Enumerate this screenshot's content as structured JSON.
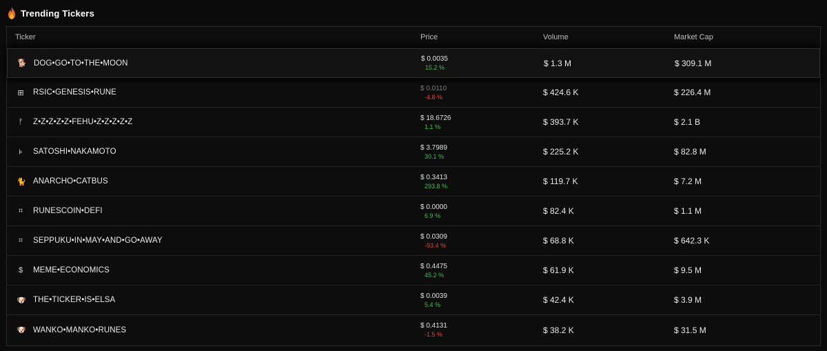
{
  "header": {
    "title": "Trending Tickers",
    "icon": "flame-icon"
  },
  "table": {
    "columns": [
      "Ticker",
      "Price",
      "Volume",
      "Market Cap"
    ],
    "rows": [
      {
        "icon": "🐕",
        "icon_name": "dog-icon",
        "ticker": "DOG•GO•TO•THE•MOON",
        "price": "$ 0.0035",
        "change": "15.2 %",
        "direction": "up",
        "volume": "$ 1.3 M",
        "market_cap": "$ 309.1 M"
      },
      {
        "icon": "⊞",
        "icon_name": "grid-icon",
        "ticker": "RSIC•GENESIS•RUNE",
        "price": "$ 0.0110",
        "change": "-4.8 %",
        "direction": "down",
        "volume": "$ 424.6 K",
        "market_cap": "$ 226.4 M"
      },
      {
        "icon": "ᚠ",
        "icon_name": "fehu-rune-icon",
        "ticker": "Z•Z•Z•Z•Z•FEHU•Z•Z•Z•Z•Z",
        "price": "$ 18.6726",
        "change": "1.1 %",
        "direction": "up",
        "volume": "$ 393.7 K",
        "market_cap": "$ 2.1 B"
      },
      {
        "icon": "⊧",
        "icon_name": "satoshi-icon",
        "ticker": "SATOSHI•NAKAMOTO",
        "price": "$ 3.7989",
        "change": "30.1 %",
        "direction": "up",
        "volume": "$ 225.2 K",
        "market_cap": "$ 82.8 M"
      },
      {
        "icon": "🐈",
        "icon_name": "cat-icon",
        "ticker": "ANARCHO•CATBUS",
        "price": "$ 0.3413",
        "change": "293.8 %",
        "direction": "up",
        "volume": "$ 119.7 K",
        "market_cap": "$ 7.2 M"
      },
      {
        "icon": "⌗",
        "icon_name": "rune-icon",
        "ticker": "RUNESCOIN•DEFI",
        "price": "$ 0.0000",
        "change": "6.9 %",
        "direction": "up",
        "volume": "$ 82.4 K",
        "market_cap": "$ 1.1 M"
      },
      {
        "icon": "⌗",
        "icon_name": "rune-icon",
        "ticker": "SEPPUKU•IN•MAY•AND•GO•AWAY",
        "price": "$ 0.0309",
        "change": "-93.4 %",
        "direction": "down",
        "volume": "$ 68.8 K",
        "market_cap": "$ 642.3 K"
      },
      {
        "icon": "$",
        "icon_name": "dollar-icon",
        "ticker": "MEME•ECONOMICS",
        "price": "$ 0.4475",
        "change": "45.2 %",
        "direction": "up",
        "volume": "$ 61.9 K",
        "market_cap": "$ 9.5 M"
      },
      {
        "icon": "🐶",
        "icon_name": "dog-face-icon",
        "ticker": "THE•TICKER•IS•ELSA",
        "price": "$ 0.0039",
        "change": "5.4 %",
        "direction": "up",
        "volume": "$ 42.4 K",
        "market_cap": "$ 3.9 M"
      },
      {
        "icon": "🐶",
        "icon_name": "dog-face-icon",
        "ticker": "WANKO•MANKO•RUNES",
        "price": "$ 0.4131",
        "change": "-1.5 %",
        "direction": "down",
        "volume": "$ 38.2 K",
        "market_cap": "$ 31.5 M"
      }
    ]
  },
  "colors": {
    "positive": "#3fbf4f",
    "negative": "#e0453f",
    "background": "#0b0b0b"
  }
}
